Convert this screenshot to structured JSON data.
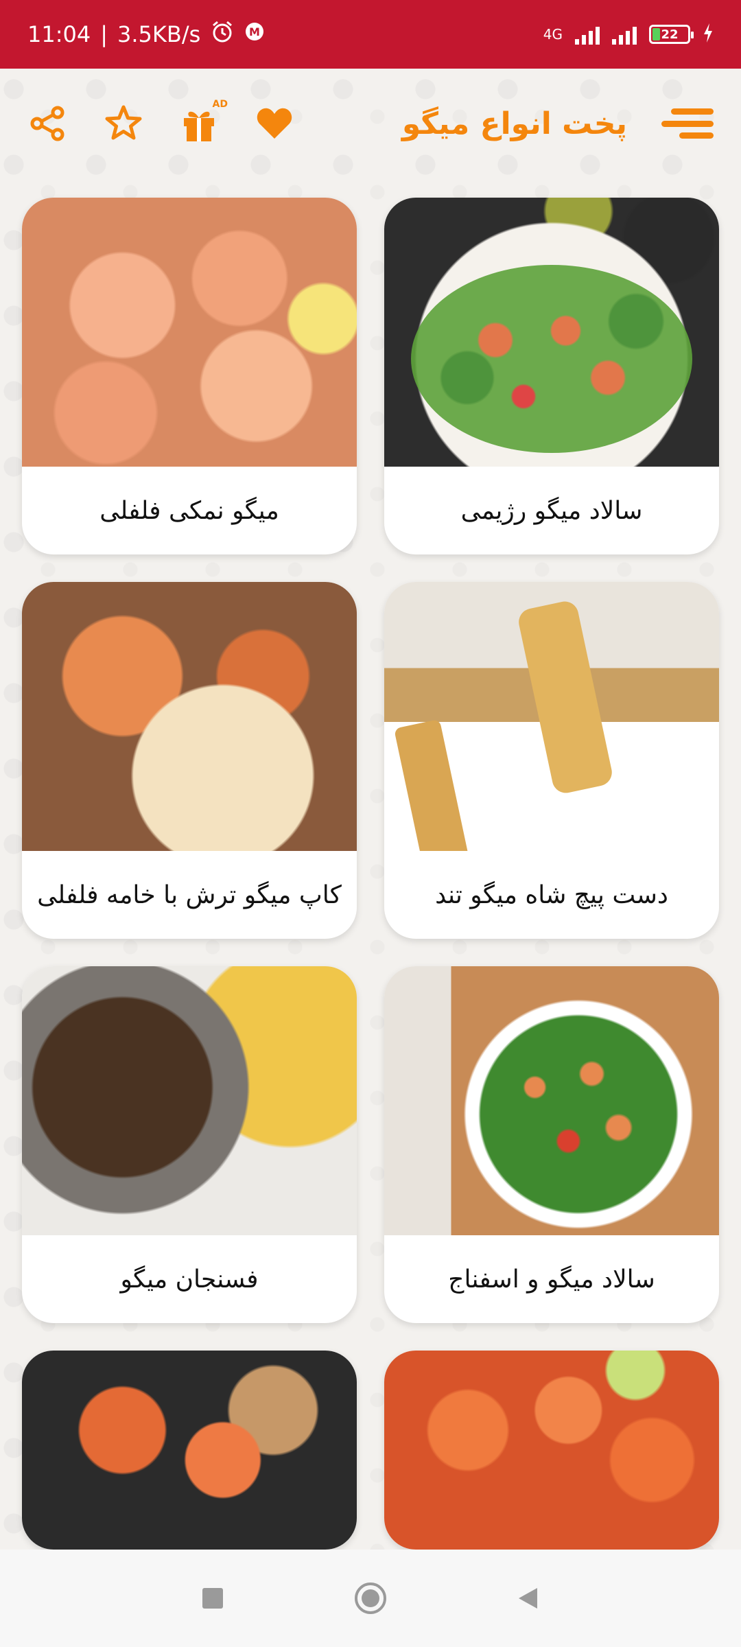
{
  "status_bar": {
    "time": "11:04",
    "speed": "3.5KB/s",
    "network": "4G",
    "battery": "22"
  },
  "header": {
    "title": "پخت انواع میگو",
    "ad_badge": "AD",
    "icons": [
      "share-icon",
      "star-icon",
      "gift-icon",
      "heart-icon",
      "menu-icon"
    ],
    "accent_color": "#f4860d",
    "status_color": "#c3172f"
  },
  "recipes": [
    {
      "title": "سالاد میگو رژیمی"
    },
    {
      "title": "میگو نمکی فلفلی"
    },
    {
      "title": "دست پیچ شاه میگو تند"
    },
    {
      "title": "کاپ میگو ترش با خامه فلفلی"
    },
    {
      "title": "سالاد میگو و اسفناج"
    },
    {
      "title": "فسنجان میگو"
    }
  ],
  "nav": [
    "square-icon",
    "home-circle-icon",
    "back-triangle-icon"
  ]
}
